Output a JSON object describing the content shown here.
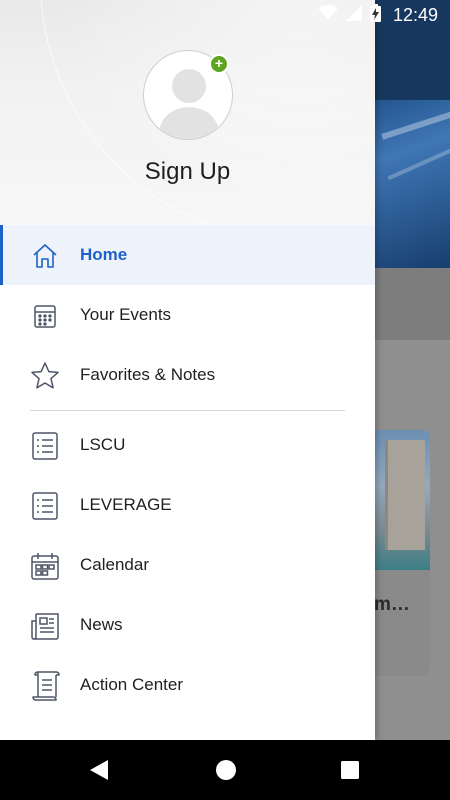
{
  "status_bar": {
    "time": "12:49"
  },
  "drawer": {
    "header": {
      "signup_label": "Sign Up"
    },
    "menu": [
      {
        "label": "Home",
        "icon": "home-icon",
        "active": true
      },
      {
        "label": "Your Events",
        "icon": "events-calendar-icon"
      },
      {
        "label": "Favorites & Notes",
        "icon": "star-icon"
      },
      {
        "label": "LSCU",
        "icon": "list-icon"
      },
      {
        "label": "LEVERAGE",
        "icon": "list-icon"
      },
      {
        "label": "Calendar",
        "icon": "calendar-icon"
      },
      {
        "label": "News",
        "icon": "newspaper-icon"
      },
      {
        "label": "Action Center",
        "icon": "scroll-icon"
      }
    ]
  },
  "background": {
    "card_title_fragment": "m…"
  },
  "colors": {
    "accent": "#1f62c7",
    "add_badge": "#5ea51f",
    "app_bar": "#17385e"
  }
}
